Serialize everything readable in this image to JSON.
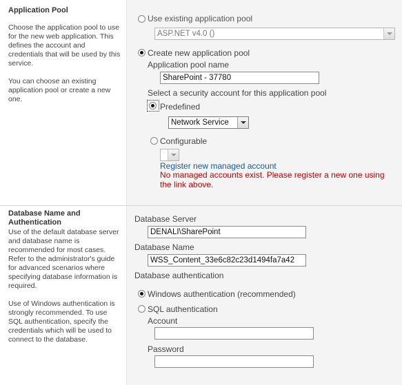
{
  "app_pool": {
    "title": "Application Pool",
    "description_1": "Choose the application pool to use for the new web application. This defines the account and credentials that will be used by this service.",
    "description_2": "You can choose an existing application pool or create a new one.",
    "use_existing_label": "Use existing application pool",
    "existing_pool_selected": "ASP.NET v4.0 ()",
    "create_new_label": "Create new application pool",
    "pool_name_label": "Application pool name",
    "pool_name_value": "SharePoint - 37780",
    "security_account_label": "Select a security account for this application pool",
    "predefined_label": "Predefined",
    "predefined_selected": "Network Service",
    "configurable_label": "Configurable",
    "configurable_selected": "",
    "register_link": "Register new managed account",
    "error_message": "No managed accounts exist. Please register a new one using the link above."
  },
  "database": {
    "title": "Database Name and Authentication",
    "description_1": "Use of the default database server and database name is recommended for most cases. Refer to the administrator's guide for advanced scenarios where specifying database information is required.",
    "description_2": "Use of Windows authentication is strongly recommended. To use SQL authentication, specify the credentials which will be used to connect to the database.",
    "server_label": "Database Server",
    "server_value": "DENALI\\SharePoint",
    "name_label": "Database Name",
    "name_value": "WSS_Content_33e6c82c23d1494fa7a42",
    "auth_label": "Database authentication",
    "windows_auth_label": "Windows authentication (recommended)",
    "sql_auth_label": "SQL authentication",
    "account_label": "Account",
    "account_value": "",
    "password_label": "Password",
    "password_value": ""
  }
}
